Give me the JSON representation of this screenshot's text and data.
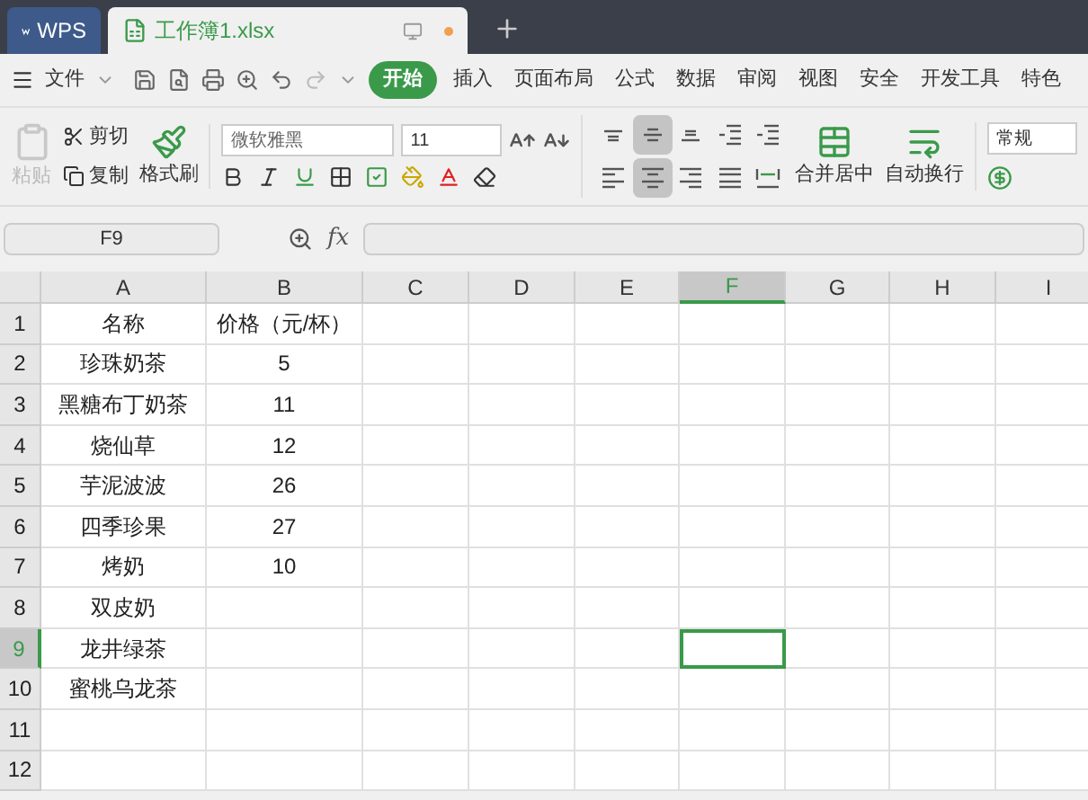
{
  "tabs": [
    {
      "label": "WPS",
      "kind": "app",
      "selected": false
    },
    {
      "label": "工作簿1.xlsx",
      "kind": "doc",
      "selected": true
    }
  ],
  "menu": {
    "file": "文件",
    "tabs": [
      {
        "label": "开始",
        "selected": true
      },
      {
        "label": "插入",
        "selected": false
      },
      {
        "label": "页面布局",
        "selected": false
      },
      {
        "label": "公式",
        "selected": false
      },
      {
        "label": "数据",
        "selected": false
      },
      {
        "label": "审阅",
        "selected": false
      },
      {
        "label": "视图",
        "selected": false
      },
      {
        "label": "安全",
        "selected": false
      },
      {
        "label": "开发工具",
        "selected": false
      },
      {
        "label": "特色",
        "selected": false
      }
    ]
  },
  "ribbon": {
    "paste": {
      "label": "粘贴",
      "disabled": true
    },
    "cut": "剪切",
    "copy": "复制",
    "format_painter": "格式刷",
    "font": "微软雅黑",
    "size": "11",
    "merge": "合并居中",
    "wrap": "自动换行",
    "number_format": "常规",
    "align": [
      {
        "kind": "top",
        "selected": false
      },
      {
        "kind": "middle",
        "selected": true
      },
      {
        "kind": "bottom",
        "selected": false
      },
      {
        "kind": "outdent",
        "selected": false
      },
      {
        "kind": "indent",
        "selected": false
      },
      {
        "kind": "left",
        "selected": false
      },
      {
        "kind": "center",
        "selected": true
      },
      {
        "kind": "right",
        "selected": false
      },
      {
        "kind": "justify",
        "selected": false
      },
      {
        "kind": "distributed",
        "selected": false
      }
    ]
  },
  "name_box": "F9",
  "formula_bar": {
    "label": "fx"
  },
  "columns": [
    {
      "label": "A",
      "selected": false
    },
    {
      "label": "B",
      "selected": false
    },
    {
      "label": "C",
      "selected": false
    },
    {
      "label": "D",
      "selected": false
    },
    {
      "label": "E",
      "selected": false
    },
    {
      "label": "F",
      "selected": true
    },
    {
      "label": "G",
      "selected": false
    },
    {
      "label": "H",
      "selected": false
    },
    {
      "label": "I",
      "selected": false
    }
  ],
  "rows": [
    {
      "label": "1",
      "selected": false,
      "cells": [
        "名称",
        "价格（元/杯）"
      ]
    },
    {
      "label": "2",
      "selected": false,
      "cells": [
        "珍珠奶茶",
        "5"
      ]
    },
    {
      "label": "3",
      "selected": false,
      "cells": [
        "黑糖布丁奶茶",
        "11"
      ]
    },
    {
      "label": "4",
      "selected": false,
      "cells": [
        "烧仙草",
        "12"
      ]
    },
    {
      "label": "5",
      "selected": false,
      "cells": [
        "芋泥波波",
        "26"
      ]
    },
    {
      "label": "6",
      "selected": false,
      "cells": [
        "四季珍果",
        "27"
      ]
    },
    {
      "label": "7",
      "selected": false,
      "cells": [
        "烤奶",
        "10"
      ]
    },
    {
      "label": "8",
      "selected": false,
      "cells": [
        "双皮奶"
      ]
    },
    {
      "label": "9",
      "selected": true,
      "cells": [
        "龙井绿茶"
      ]
    },
    {
      "label": "10",
      "selected": false,
      "cells": [
        "蜜桃乌龙茶"
      ]
    },
    {
      "label": "11",
      "selected": false,
      "cells": []
    },
    {
      "label": "12",
      "selected": false,
      "cells": []
    }
  ]
}
